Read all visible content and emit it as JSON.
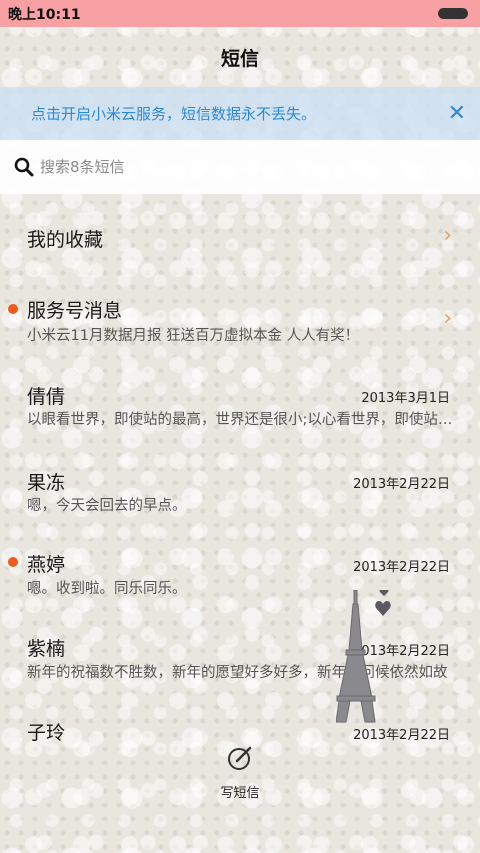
{
  "statusbar": {
    "time": "晚上10:11"
  },
  "header": {
    "title": "短信"
  },
  "banner": {
    "text": "点击开启小米云服务，短信数据永不丢失。"
  },
  "search": {
    "placeholder": "搜索8条短信"
  },
  "favorites": {
    "label": "我的收藏"
  },
  "conversations": [
    {
      "name": "服务号消息",
      "preview": "小米云11月数据月报 狂送百万虚拟本金 人人有奖！",
      "date": "",
      "unread": true
    },
    {
      "name": "倩倩",
      "preview": "以眼看世界，即使站的最高，世界还是很小;以心看世界，即使站的最低，世界也是很大",
      "date": "2013年3月1日",
      "unread": false
    },
    {
      "name": "果冻",
      "preview": "嗯，今天会回去的早点。",
      "date": "2013年2月22日",
      "unread": false
    },
    {
      "name": "燕婷",
      "preview": "嗯。收到啦。同乐同乐。",
      "date": "2013年2月22日",
      "unread": true
    },
    {
      "name": "紫楠",
      "preview": "新年的祝福数不胜数，新年的愿望好多好多，新年的问候依然如故",
      "date": "2013年2月22日",
      "unread": false
    },
    {
      "name": "子玲",
      "preview": "",
      "date": "2013年2月22日",
      "unread": false
    }
  ],
  "compose": {
    "label": "写短信",
    "icon": "compose-icon"
  },
  "colors": {
    "statusbar": "#f7a1a4",
    "accent": "#2c8ad6",
    "unread": "#f05a1a",
    "chevron": "#e8a060"
  }
}
